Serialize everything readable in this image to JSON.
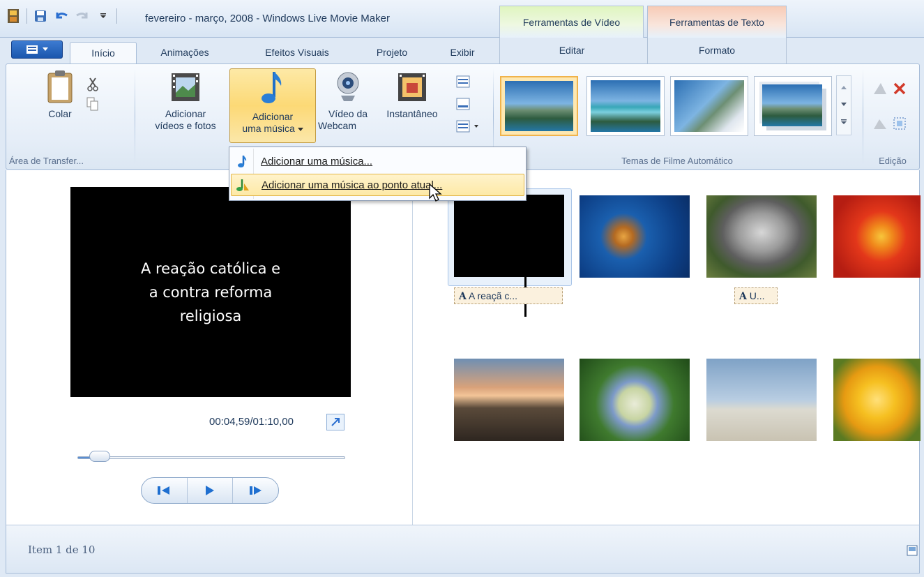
{
  "window": {
    "title": "fevereiro - março, 2008 - Windows Live Movie Maker"
  },
  "context_tabs": {
    "video": "Ferramentas de Vídeo",
    "texto": "Ferramentas de Texto",
    "video_sub": "Editar",
    "texto_sub": "Formato"
  },
  "tabs": [
    "Início",
    "Animações",
    "Efeitos Visuais",
    "Projeto",
    "Exibir"
  ],
  "ribbon": {
    "clipboard": {
      "paste": "Colar",
      "group_label": "Área de Transfer..."
    },
    "add": {
      "add_videos": [
        "Adicionar",
        "vídeos e fotos"
      ],
      "add_music": [
        "Adicionar",
        "uma música"
      ],
      "webcam": [
        "Vídeo da",
        "Webcam"
      ],
      "snapshot": "Instantâneo"
    },
    "themes": {
      "group_label": "Temas de Filme Automático"
    },
    "edit": {
      "group_label": "Edição"
    }
  },
  "dropdown": {
    "items": [
      "Adicionar uma música...",
      "Adicionar uma música ao ponto atual..."
    ]
  },
  "preview": {
    "text_lines": [
      "A reação católica e",
      "a contra reforma",
      "religiosa"
    ],
    "timecode": "00:04,59/01:10,00",
    "seek_progress": 0.06
  },
  "storyboard": {
    "captions": [
      "A reaçã  c...",
      "U..."
    ]
  },
  "status": {
    "item_text": "Item 1 de 10"
  },
  "colors": {
    "accent": "#1a56ad",
    "selection": "#fcd976"
  }
}
